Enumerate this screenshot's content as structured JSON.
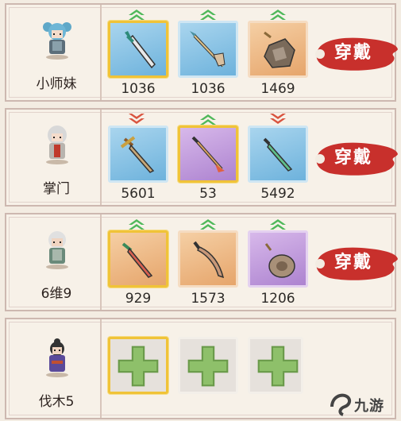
{
  "wear_label": "穿戴",
  "rows": [
    {
      "name": "小师妹",
      "slots": [
        {
          "value": "1036",
          "rarity": "blue",
          "selected": true,
          "arrow": "up",
          "icon": "sword-icon"
        },
        {
          "value": "1036",
          "rarity": "blue",
          "selected": false,
          "arrow": "up",
          "icon": "spear-icon"
        },
        {
          "value": "1469",
          "rarity": "orange",
          "selected": false,
          "arrow": "up",
          "icon": "ore-pouch-icon"
        }
      ]
    },
    {
      "name": "掌门",
      "slots": [
        {
          "value": "5601",
          "rarity": "blue",
          "selected": false,
          "arrow": "down",
          "icon": "sword-icon"
        },
        {
          "value": "53",
          "rarity": "purple",
          "selected": true,
          "arrow": "up",
          "icon": "spear-icon"
        },
        {
          "value": "5492",
          "rarity": "blue",
          "selected": false,
          "arrow": "down",
          "icon": "sword-icon"
        }
      ]
    },
    {
      "name": "6维9",
      "slots": [
        {
          "value": "929",
          "rarity": "orange",
          "selected": true,
          "arrow": "up",
          "icon": "sword-icon"
        },
        {
          "value": "1573",
          "rarity": "orange",
          "selected": false,
          "arrow": "up",
          "icon": "blade-icon"
        },
        {
          "value": "1206",
          "rarity": "purple",
          "selected": false,
          "arrow": "up",
          "icon": "pouch-icon"
        }
      ]
    },
    {
      "name": "伐木5",
      "slots": [
        {
          "value": "",
          "rarity": "empty",
          "selected": true,
          "arrow": "",
          "icon": "plus-icon"
        },
        {
          "value": "",
          "rarity": "empty",
          "selected": false,
          "arrow": "",
          "icon": "plus-icon"
        },
        {
          "value": "",
          "rarity": "empty",
          "selected": false,
          "arrow": "",
          "icon": "plus-icon"
        }
      ]
    }
  ],
  "colors": {
    "up_arrow": "#4fb85a",
    "down_arrow": "#d9543f",
    "button_red": "#c8302c"
  },
  "watermark": "九游"
}
